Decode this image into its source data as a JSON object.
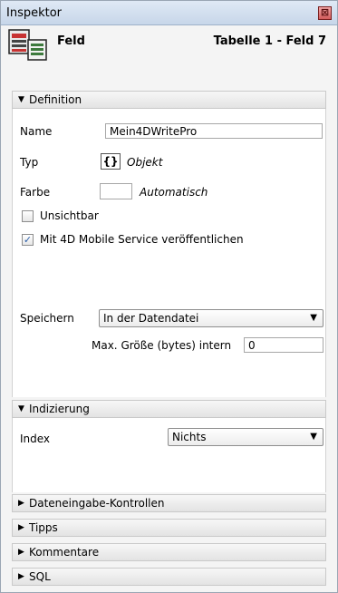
{
  "window": {
    "title": "Inspektor",
    "close_glyph": "⊠"
  },
  "header": {
    "title": "Feld",
    "table_field": "Tabelle 1 - Feld 7",
    "icon": "field-table-icon"
  },
  "definition": {
    "section_label": "Definition",
    "name_label": "Name",
    "name_value": "Mein4DWritePro",
    "type_label": "Typ",
    "type_icon_text": "{}",
    "type_value": "Objekt",
    "color_label": "Farbe",
    "color_value": "Automatisch",
    "invisible_label": "Unsichtbar",
    "invisible_checked": false,
    "mobile_label": "Mit 4D Mobile Service veröffentlichen",
    "mobile_checked": true,
    "save_label": "Speichern",
    "save_value": "In der Datendatei",
    "maxsize_label": "Max. Größe (bytes) intern",
    "maxsize_value": "0"
  },
  "indexing": {
    "section_label": "Indizierung",
    "index_label": "Index",
    "index_value": "Nichts"
  },
  "collapsed_sections": [
    {
      "label": "Dateneingabe-Kontrollen"
    },
    {
      "label": "Tipps"
    },
    {
      "label": "Kommentare"
    },
    {
      "label": "SQL"
    }
  ],
  "colors": {
    "title_bar": "#c7d6e9",
    "check_mark": "#2a5ea8",
    "close_button": "#d25b5b"
  }
}
